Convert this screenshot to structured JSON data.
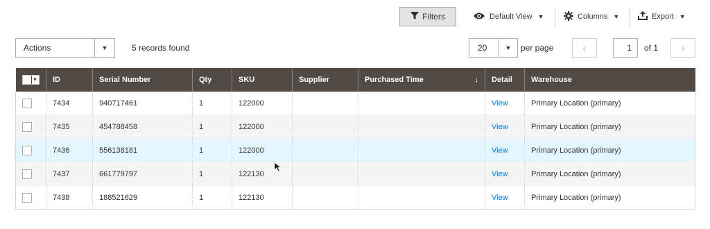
{
  "toolbar": {
    "filters_label": "Filters",
    "view_label": "Default View",
    "columns_label": "Columns",
    "export_label": "Export"
  },
  "actions": {
    "label": "Actions",
    "records_found": "5 records found"
  },
  "pagination": {
    "per_page_value": "20",
    "per_page_label": "per page",
    "prev_glyph": "‹",
    "next_glyph": "›",
    "current_page": "1",
    "of_label": "of 1"
  },
  "table": {
    "columns": [
      "ID",
      "Serial Number",
      "Qty",
      "SKU",
      "Supplier",
      "Purchased Time",
      "Detail",
      "Warehouse"
    ],
    "sort_indicator": "↓",
    "rows": [
      {
        "id": "7434",
        "serial": "940717461",
        "qty": "1",
        "sku": "122000",
        "supplier": "",
        "purchased": "",
        "detail": "View",
        "warehouse": "Primary Location (primary)"
      },
      {
        "id": "7435",
        "serial": "454788458",
        "qty": "1",
        "sku": "122000",
        "supplier": "",
        "purchased": "",
        "detail": "View",
        "warehouse": "Primary Location (primary)"
      },
      {
        "id": "7436",
        "serial": "556138181",
        "qty": "1",
        "sku": "122000",
        "supplier": "",
        "purchased": "",
        "detail": "View",
        "warehouse": "Primary Location (primary)"
      },
      {
        "id": "7437",
        "serial": "661779797",
        "qty": "1",
        "sku": "122130",
        "supplier": "",
        "purchased": "",
        "detail": "View",
        "warehouse": "Primary Location (primary)"
      },
      {
        "id": "7438",
        "serial": "188521629",
        "qty": "1",
        "sku": "122130",
        "supplier": "",
        "purchased": "",
        "detail": "View",
        "warehouse": "Primary Location (primary)"
      }
    ]
  },
  "colors": {
    "header_bg": "#514943",
    "link": "#007bdb",
    "hover_row": "#e5f7fe"
  },
  "icons": {
    "filter": "funnel-icon",
    "view": "eye-icon",
    "columns": "gear-icon",
    "export": "export-icon",
    "cursor": "mouse-pointer-icon"
  }
}
